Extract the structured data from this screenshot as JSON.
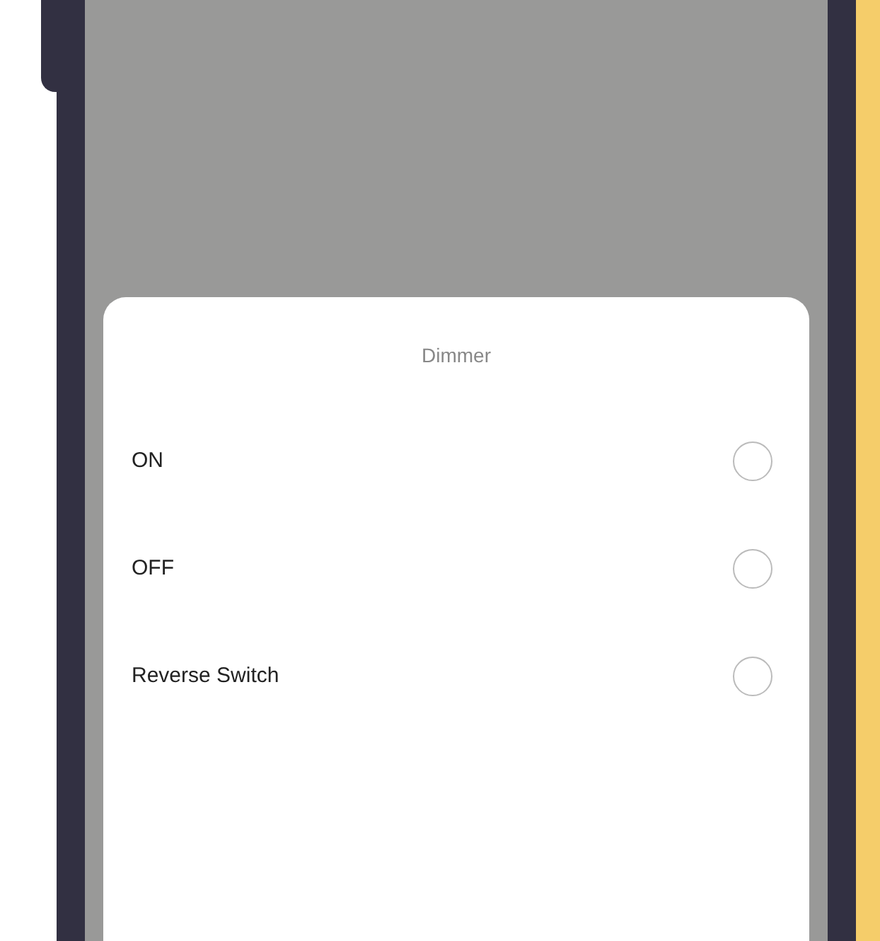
{
  "sheet": {
    "title": "Dimmer",
    "options": [
      {
        "label": "ON",
        "selected": false
      },
      {
        "label": "OFF",
        "selected": false
      },
      {
        "label": "Reverse Switch",
        "selected": false
      }
    ]
  }
}
